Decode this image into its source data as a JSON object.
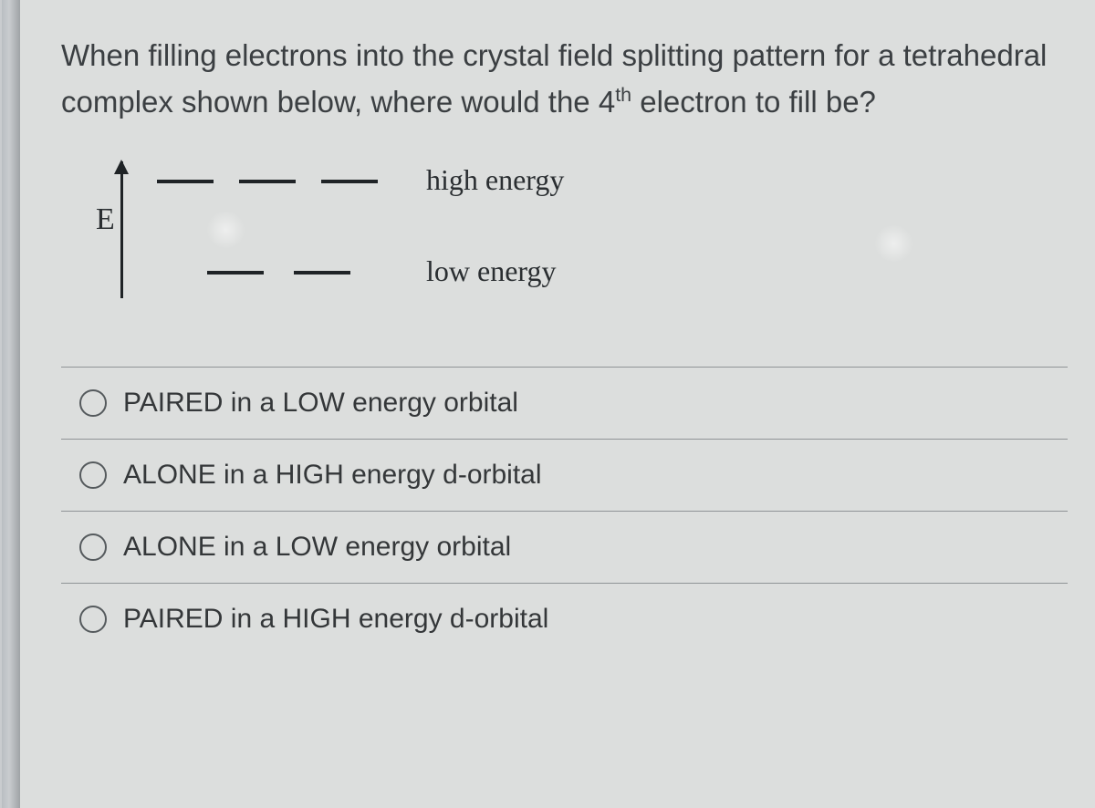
{
  "question": {
    "text_before_sup": "When filling electrons into the crystal field splitting pattern for a tetrahedral complex shown below, where would the 4",
    "sup": "th",
    "text_after_sup": " electron to fill be?"
  },
  "diagram": {
    "axis_label": "E",
    "high_label": "high energy",
    "low_label": "low energy"
  },
  "options": [
    {
      "label": "PAIRED in a LOW energy orbital"
    },
    {
      "label": "ALONE in a HIGH energy d-orbital"
    },
    {
      "label": "ALONE in a LOW energy orbital"
    },
    {
      "label": "PAIRED in a HIGH energy d-orbital"
    }
  ]
}
